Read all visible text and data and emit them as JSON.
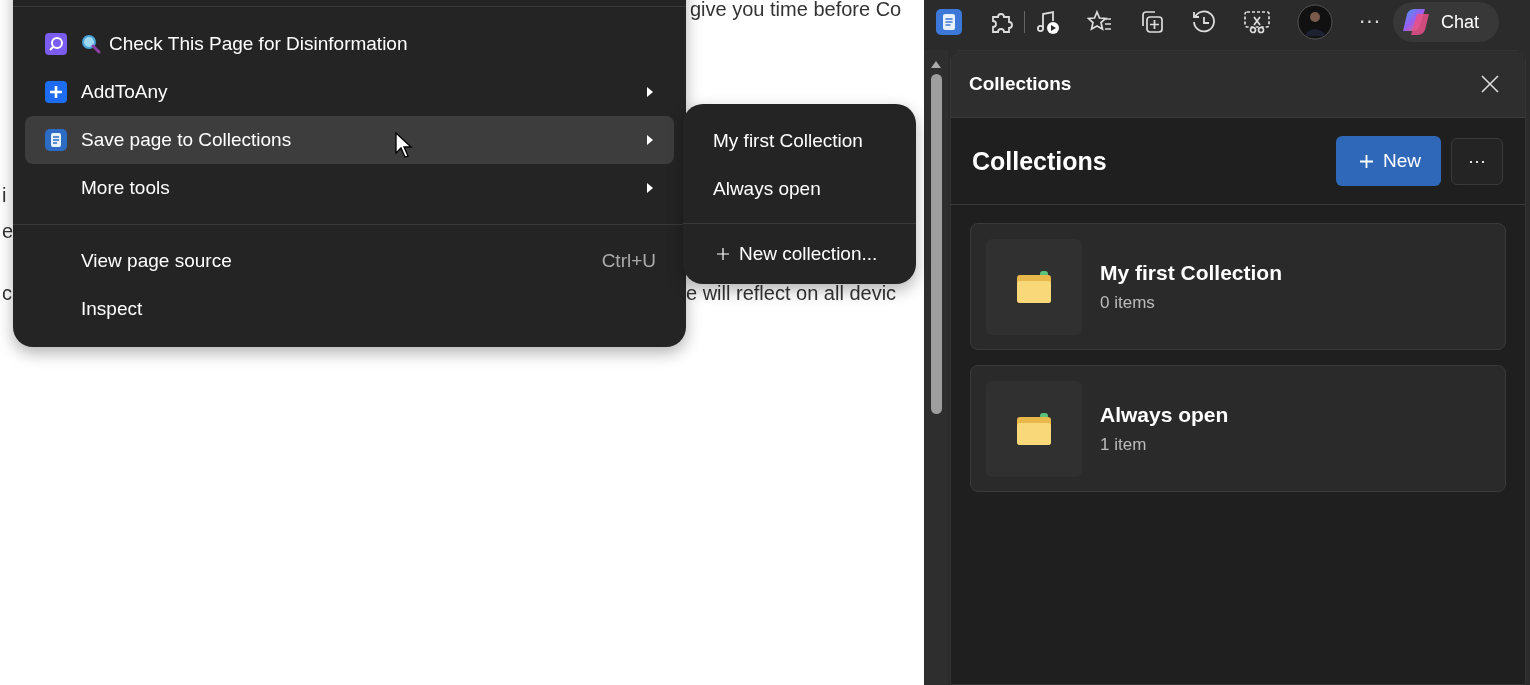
{
  "page_fragments": [
    "give you time before Co",
    "i",
    "e",
    "c",
    "e will reflect on all devic"
  ],
  "context_menu": {
    "items": [
      {
        "label": "Check This Page for Disinformation",
        "kind": "extension-check",
        "submenu": false,
        "selected": false
      },
      {
        "label": "AddToAny",
        "kind": "extension-plus",
        "submenu": true,
        "selected": false
      },
      {
        "label": "Save page to Collections",
        "kind": "collections",
        "submenu": true,
        "selected": true
      },
      {
        "label": "More tools",
        "kind": "plain",
        "submenu": true,
        "selected": false
      },
      {
        "label": "View page source",
        "kind": "plain",
        "submenu": false,
        "selected": false,
        "shortcut": "Ctrl+U",
        "divider_before": true
      },
      {
        "label": "Inspect",
        "kind": "plain",
        "submenu": false,
        "selected": false
      }
    ]
  },
  "submenu": {
    "items": [
      {
        "label": "My first Collection"
      },
      {
        "label": "Always open"
      }
    ],
    "new_label": "New collection..."
  },
  "toolbar": {
    "chat_label": "Chat",
    "more": "···"
  },
  "panel": {
    "title": "Collections",
    "heading": "Collections",
    "new_button": "New",
    "more_button": "···",
    "collections": [
      {
        "name": "My first Collection",
        "count": "0 items"
      },
      {
        "name": "Always open",
        "count": "1 item"
      }
    ]
  }
}
